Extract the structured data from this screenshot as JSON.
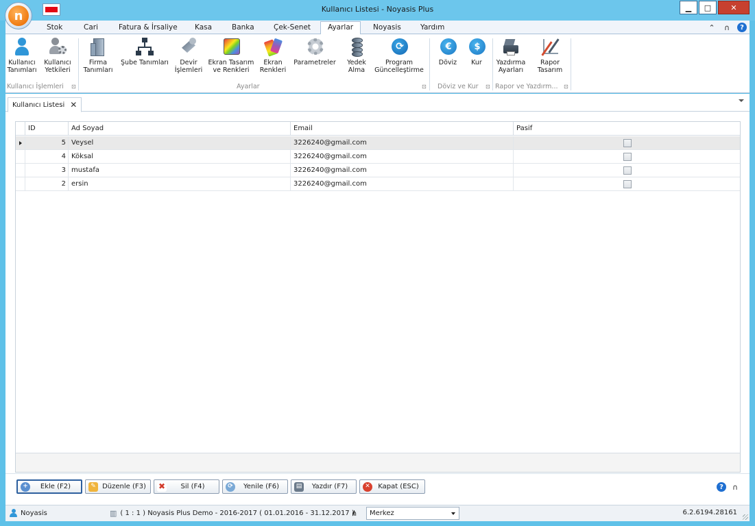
{
  "window": {
    "title": "Kullanıcı Listesi - Noyasis Plus",
    "logo_letter": "n"
  },
  "ribbon": {
    "tabs": [
      "Stok",
      "Cari",
      "Fatura & İrsaliye",
      "Kasa",
      "Banka",
      "Çek-Senet",
      "Ayarlar",
      "Noyasis",
      "Yardım"
    ],
    "active_tab": "Ayarlar",
    "groups": [
      {
        "label": "Kullanıcı İşlemleri",
        "buttons": [
          {
            "line1": "Kullanıcı",
            "line2": "Tanımları",
            "icon": "user-icon"
          },
          {
            "line1": "Kullanıcı",
            "line2": "Yetkileri",
            "icon": "user-permission-icon"
          }
        ]
      },
      {
        "label": "Ayarlar",
        "buttons": [
          {
            "line1": "Firma",
            "line2": "Tanımları",
            "icon": "building-icon"
          },
          {
            "line1": "Şube Tanımları",
            "line2": "",
            "icon": "branch-tree-icon"
          },
          {
            "line1": "Devir",
            "line2": "İşlemleri",
            "icon": "transfer-icon"
          },
          {
            "line1": "Ekran Tasarım",
            "line2": "ve Renkleri",
            "icon": "screen-design-icon"
          },
          {
            "line1": "Ekran",
            "line2": "Renkleri",
            "icon": "palette-icon"
          },
          {
            "line1": "Parametreler",
            "line2": "",
            "icon": "gear-icon"
          },
          {
            "line1": "Yedek",
            "line2": "Alma",
            "icon": "database-icon"
          },
          {
            "line1": "Program",
            "line2": "Güncelleştirme",
            "icon": "update-icon"
          }
        ]
      },
      {
        "label": "Döviz ve Kur",
        "buttons": [
          {
            "line1": "Döviz",
            "line2": "",
            "icon": "euro-icon",
            "glyph": "€"
          },
          {
            "line1": "Kur",
            "line2": "",
            "icon": "dollar-icon",
            "glyph": "$"
          }
        ]
      },
      {
        "label": "Rapor ve Yazdırm...",
        "buttons": [
          {
            "line1": "Yazdırma",
            "line2": "Ayarları",
            "icon": "printer-icon"
          },
          {
            "line1": "Rapor",
            "line2": "Tasarım",
            "icon": "report-design-icon"
          }
        ]
      }
    ]
  },
  "document_tab": {
    "label": "Kullanıcı Listesi",
    "close": "✕"
  },
  "grid": {
    "columns": [
      "ID",
      "Ad Soyad",
      "Email",
      "Pasif"
    ],
    "rows": [
      {
        "id": "5",
        "name": "Veysel",
        "email": "3226240@gmail.com",
        "pasif": false
      },
      {
        "id": "4",
        "name": "Köksal",
        "email": "3226240@gmail.com",
        "pasif": false
      },
      {
        "id": "3",
        "name": "mustafa",
        "email": "3226240@gmail.com",
        "pasif": false
      },
      {
        "id": "2",
        "name": "ersin",
        "email": "3226240@gmail.com",
        "pasif": false
      }
    ],
    "selected_row": 0
  },
  "buttons": {
    "add": "Ekle (F2)",
    "edit": "Düzenle (F3)",
    "delete": "Sil (F4)",
    "refresh": "Yenile (F6)",
    "print": "Yazdır (F7)",
    "close": "Kapat (ESC)"
  },
  "statusbar": {
    "user": "Noyasis",
    "company": "( 1 : 1 )  Noyasis Plus Demo - 2016-2017  ( 01.01.2016 - 31.12.2017 )",
    "branch": "Merkez",
    "version": "6.2.6194.28161"
  },
  "colors": {
    "accent": "#5fc1e8",
    "close_button": "#c7402f",
    "icon_blue": "#2f96d8"
  }
}
